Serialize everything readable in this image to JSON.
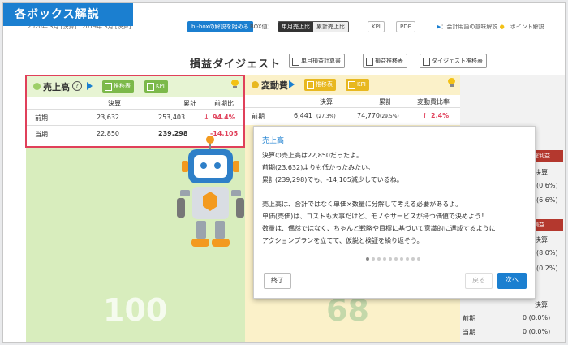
{
  "corner_label": "各ボックス解説",
  "topbar": {
    "period": "2020年 3月 [決算]…2019年 3月 [決算]",
    "start_button": "bi-boxの解説を始める",
    "box_value_label": "BOX値：",
    "seg_on": "単月売上比",
    "seg_off": "累計売上比",
    "kpi_btn": "KPI",
    "pdf_btn": "PDF",
    "legend": "：会計用語の意味解説",
    "legend2": "：ポイント解説"
  },
  "page_title": "損益ダイジェスト",
  "title_buttons": [
    "単月損益計算書",
    "損益推移表",
    "ダイジェスト推移表"
  ],
  "sales": {
    "title": "売上高",
    "q_badge": "?",
    "btn_trend": "推移表",
    "btn_kpi": "KPI",
    "headers": [
      "決算",
      "累計",
      "前期比"
    ],
    "rows": [
      {
        "label": "前期",
        "kessan": "23,632",
        "ruikei": "253,403",
        "hi": "94.4%",
        "hi_icon": "down-arrow-icon"
      },
      {
        "label": "当期",
        "kessan": "22,850",
        "ruikei": "239,298",
        "hi": "-14,105"
      }
    ],
    "big_number": "100"
  },
  "variable": {
    "title": "変動費",
    "btn_trend": "推移表",
    "btn_kpi": "KPI",
    "headers": [
      "決算",
      "累計",
      "変動費比率"
    ],
    "rows": [
      {
        "label": "前期",
        "kessan": "6,441",
        "kessan_pct": "(27.3%)",
        "ruikei": "74,770",
        "ruikei_pct": "(29.5%)",
        "hi": "2.4%"
      }
    ],
    "big_number": "68"
  },
  "right_column": {
    "tag1": "総利益",
    "r1": "決算",
    "r2": "(0.6%)",
    "r3": "(6.6%)",
    "tag2": "損益",
    "r4": "決算",
    "r5": "(8.0%)",
    "r6": "(0.2%)",
    "r7": "決算",
    "r8": "0 (0.0%)",
    "r9": "0 (0.0%)",
    "label_prev": "前期",
    "label_cur": "当期"
  },
  "dialog": {
    "title": "売上高",
    "lines": [
      "決算の売上高は22,850だったよ。",
      "前期(23,632)よりも低かったみたい。",
      "累計(239,298)でも、-14,105減少しているね。",
      "",
      "売上高は、合計ではなく単価×数量に分解して考える必要があるよ。",
      "単価(売価)は、コストも大事だけど、モノやサービスが持つ価値で決めよう！",
      "数量は、偶然ではなく、ちゃんと戦略や目標に基づいて意識的に達成するように",
      "アクションプランを立てて、仮説と検証を繰り返そう。"
    ],
    "end_button": "終了",
    "back_button": "戻る",
    "next_button": "次へ",
    "page_dots": 10,
    "active_dot": 0
  }
}
